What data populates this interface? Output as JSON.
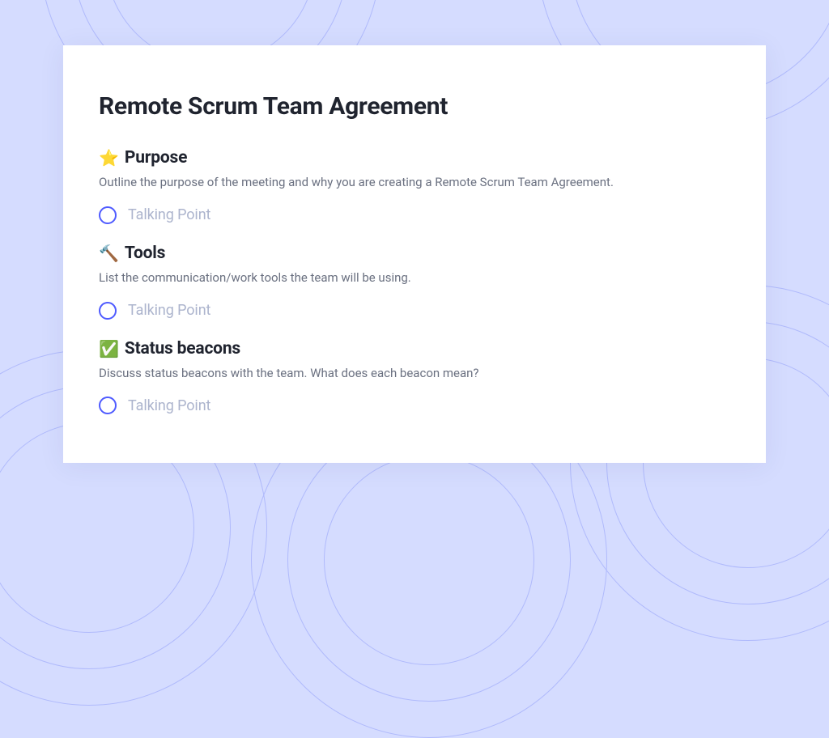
{
  "document": {
    "title": "Remote Scrum Team Agreement",
    "sections": [
      {
        "icon": "⭐",
        "icon_name": "star-icon",
        "title": "Purpose",
        "description": "Outline the purpose of the meeting and why you are creating a Remote Scrum Team Agreement.",
        "talking_point_label": "Talking Point"
      },
      {
        "icon": "🔨",
        "icon_name": "hammer-icon",
        "title": "Tools",
        "description": "List the communication/work tools the team will be using.",
        "talking_point_label": "Talking Point"
      },
      {
        "icon": "✅",
        "icon_name": "checkmark-icon",
        "title": "Status beacons",
        "description": "Discuss status beacons with the team. What does each beacon mean?",
        "talking_point_label": "Talking Point"
      }
    ]
  },
  "colors": {
    "background": "#d5dcff",
    "circle_stroke": "#b0bafc",
    "accent": "#4f5bff",
    "text_primary": "#20242f",
    "text_secondary": "#6a7080",
    "text_placeholder": "#acb4cd"
  }
}
